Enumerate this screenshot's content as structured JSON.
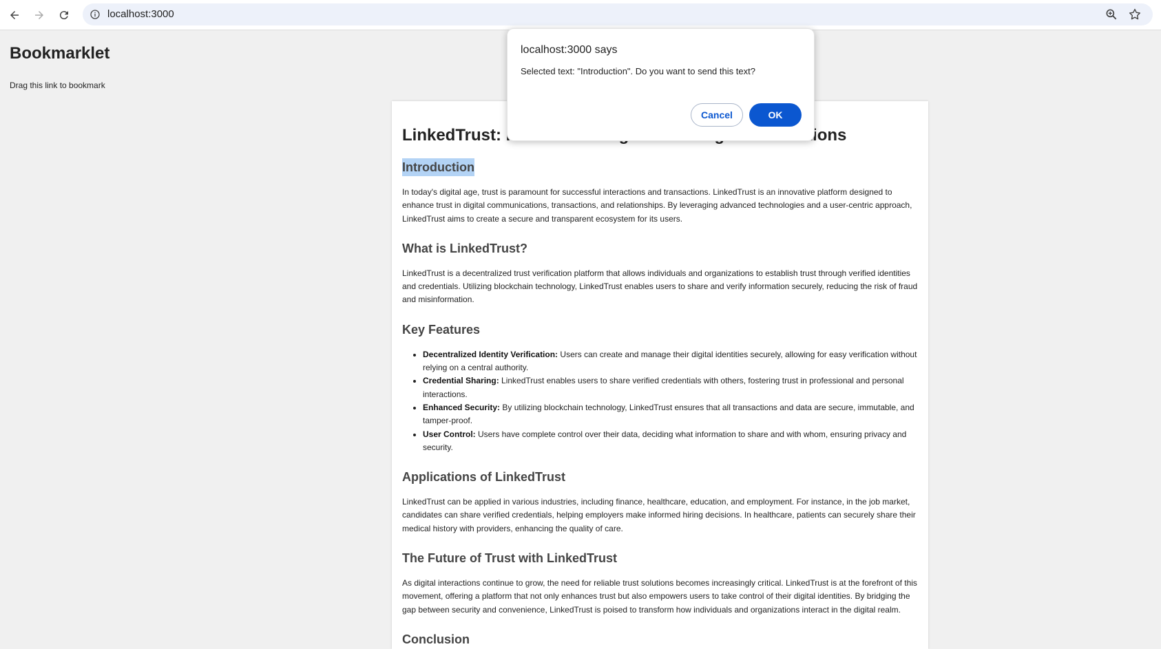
{
  "browser": {
    "url": "localhost:3000"
  },
  "page": {
    "heading": "Bookmarklet",
    "drag_link": "Drag this link to bookmark"
  },
  "article": {
    "title": "LinkedTrust: Revolutionizing Trust in Digital Interactions",
    "intro_heading": "Introduction",
    "intro_text": "In today's digital age, trust is paramount for successful interactions and transactions. LinkedTrust is an innovative platform designed to enhance trust in digital communications, transactions, and relationships. By leveraging advanced technologies and a user-centric approach, LinkedTrust aims to create a secure and transparent ecosystem for its users.",
    "what_heading": "What is LinkedTrust?",
    "what_text": "LinkedTrust is a decentralized trust verification platform that allows individuals and organizations to establish trust through verified identities and credentials. Utilizing blockchain technology, LinkedTrust enables users to share and verify information securely, reducing the risk of fraud and misinformation.",
    "features_heading": "Key Features",
    "features": [
      {
        "name": "Decentralized Identity Verification:",
        "text": " Users can create and manage their digital identities securely, allowing for easy verification without relying on a central authority."
      },
      {
        "name": "Credential Sharing:",
        "text": " LinkedTrust enables users to share verified credentials with others, fostering trust in professional and personal interactions."
      },
      {
        "name": "Enhanced Security:",
        "text": " By utilizing blockchain technology, LinkedTrust ensures that all transactions and data are secure, immutable, and tamper-proof."
      },
      {
        "name": "User Control:",
        "text": " Users have complete control over their data, deciding what information to share and with whom, ensuring privacy and security."
      }
    ],
    "applications_heading": "Applications of LinkedTrust",
    "applications_text": "LinkedTrust can be applied in various industries, including finance, healthcare, education, and employment. For instance, in the job market, candidates can share verified credentials, helping employers make informed hiring decisions. In healthcare, patients can securely share their medical history with providers, enhancing the quality of care.",
    "future_heading": "The Future of Trust with LinkedTrust",
    "future_text": "As digital interactions continue to grow, the need for reliable trust solutions becomes increasingly critical. LinkedTrust is at the forefront of this movement, offering a platform that not only enhances trust but also empowers users to take control of their digital identities. By bridging the gap between security and convenience, LinkedTrust is poised to transform how individuals and organizations interact in the digital realm.",
    "conclusion_heading": "Conclusion"
  },
  "dialog": {
    "title": "localhost:3000 says",
    "message": "Selected text: \"Introduction\". Do you want to send this text?",
    "cancel_label": "Cancel",
    "ok_label": "OK"
  },
  "colors": {
    "selection": "#b3d3f5",
    "primary_button": "#0b57d0"
  }
}
